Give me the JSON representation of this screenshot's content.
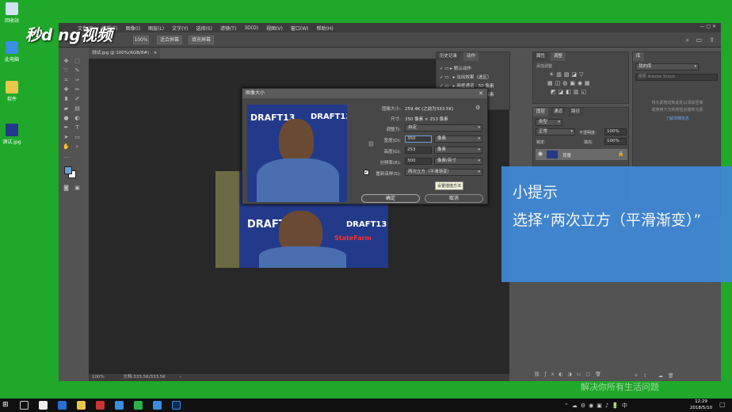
{
  "desktop": {
    "icons": [
      {
        "label": "回收站",
        "icon": "recycle-bin-icon"
      },
      {
        "label": "此电脑",
        "icon": "computer-icon"
      },
      {
        "label": "软件",
        "icon": "folder-icon"
      },
      {
        "label": "测试.jpg",
        "icon": "image-file-icon"
      }
    ]
  },
  "watermark": {
    "logo_text": "秒d ng视频"
  },
  "menubar": {
    "items": [
      "文件(F)",
      "编辑(E)",
      "图像(I)",
      "图层(L)",
      "文字(Y)",
      "选择(S)",
      "滤镜(T)",
      "3D(D)",
      "视图(V)",
      "窗口(W)",
      "帮助(H)"
    ]
  },
  "options_bar": {
    "zoom_button": "100%",
    "fit_screen": "适合屏幕",
    "fill_screen": "填充屏幕"
  },
  "document": {
    "tab_title": "测试.jpg @ 100%(RGB/8#)",
    "zoom": "100%",
    "status": "文档:333.5K/333.5K"
  },
  "history_panel": {
    "tabs": [
      "历史记录",
      "动作"
    ],
    "items": [
      "默认动作",
      "淡出效果（选区）",
      "画框通道 - 50 像素",
      "木质画框 - 50 像素"
    ]
  },
  "adjustments_panel": {
    "tabs": [
      "属性",
      "调整"
    ],
    "add_label": "添加调整"
  },
  "libraries_panel": {
    "tab": "库",
    "dropdown": "我的库",
    "search_placeholder": "搜索 Adobe Stock",
    "hint_lines": [
      "将元素拖动到此处以添加至库",
      "或使用下方的按钮创建新元素"
    ],
    "more_link": "了解详细信息"
  },
  "layers_panel": {
    "tabs": [
      "图层",
      "通道",
      "路径"
    ],
    "kind": "类型",
    "mode": "正常",
    "opacity_label": "不透明度:",
    "opacity_value": "100%",
    "lock_label": "锁定:",
    "fill_label": "填充:",
    "fill_value": "100%",
    "layer_name": "背景"
  },
  "dialog": {
    "title": "图像大小",
    "image_size_label": "图像大小:",
    "image_size_value": "259.4K (之前为333.5K)",
    "dimensions_label": "尺寸:",
    "dimensions_value": "350 像素 × 253 像素",
    "fit_to_label": "调整为:",
    "fit_to_value": "自定",
    "width_label": "宽度(D):",
    "width_value": "350",
    "width_unit": "像素",
    "height_label": "高度(G):",
    "height_value": "253",
    "height_unit": "像素",
    "resolution_label": "分辨率(R):",
    "resolution_value": "300",
    "resolution_unit": "像素/英寸",
    "resample_label": "重新采样(S):",
    "resample_value": "两次立方（平滑渐变）",
    "resample_checked": true,
    "tooltip": "设置插值方法",
    "ok_button": "确定",
    "cancel_button": "取消",
    "photo_text": "DRAFT13"
  },
  "canvas_photo": {
    "draft_text": "DRAFT13",
    "brand_text": "StateFarm"
  },
  "tip": {
    "title": "小提示",
    "body": "选择“两次立方（平滑渐变）”"
  },
  "bottom_text": "解决你所有生活问题",
  "taskbar": {
    "time": "12:29",
    "date": "2018/5/10"
  },
  "colors": {
    "desktop_green": "#1fa82a",
    "tip_blue": "#3f88d6",
    "ps_panel": "#535353"
  }
}
